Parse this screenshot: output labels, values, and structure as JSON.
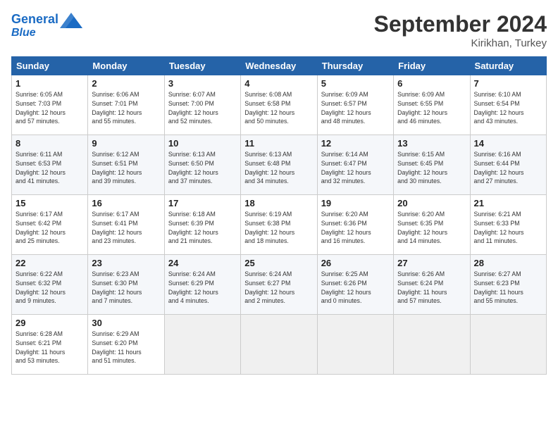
{
  "header": {
    "logo_line1": "General",
    "logo_line2": "Blue",
    "month_title": "September 2024",
    "location": "Kirikhan, Turkey"
  },
  "weekdays": [
    "Sunday",
    "Monday",
    "Tuesday",
    "Wednesday",
    "Thursday",
    "Friday",
    "Saturday"
  ],
  "weeks": [
    [
      {
        "day": "1",
        "sunrise": "6:05 AM",
        "sunset": "7:03 PM",
        "daylight": "12 hours and 57 minutes."
      },
      {
        "day": "2",
        "sunrise": "6:06 AM",
        "sunset": "7:01 PM",
        "daylight": "12 hours and 55 minutes."
      },
      {
        "day": "3",
        "sunrise": "6:07 AM",
        "sunset": "7:00 PM",
        "daylight": "12 hours and 52 minutes."
      },
      {
        "day": "4",
        "sunrise": "6:08 AM",
        "sunset": "6:58 PM",
        "daylight": "12 hours and 50 minutes."
      },
      {
        "day": "5",
        "sunrise": "6:09 AM",
        "sunset": "6:57 PM",
        "daylight": "12 hours and 48 minutes."
      },
      {
        "day": "6",
        "sunrise": "6:09 AM",
        "sunset": "6:55 PM",
        "daylight": "12 hours and 46 minutes."
      },
      {
        "day": "7",
        "sunrise": "6:10 AM",
        "sunset": "6:54 PM",
        "daylight": "12 hours and 43 minutes."
      }
    ],
    [
      {
        "day": "8",
        "sunrise": "6:11 AM",
        "sunset": "6:53 PM",
        "daylight": "12 hours and 41 minutes."
      },
      {
        "day": "9",
        "sunrise": "6:12 AM",
        "sunset": "6:51 PM",
        "daylight": "12 hours and 39 minutes."
      },
      {
        "day": "10",
        "sunrise": "6:13 AM",
        "sunset": "6:50 PM",
        "daylight": "12 hours and 37 minutes."
      },
      {
        "day": "11",
        "sunrise": "6:13 AM",
        "sunset": "6:48 PM",
        "daylight": "12 hours and 34 minutes."
      },
      {
        "day": "12",
        "sunrise": "6:14 AM",
        "sunset": "6:47 PM",
        "daylight": "12 hours and 32 minutes."
      },
      {
        "day": "13",
        "sunrise": "6:15 AM",
        "sunset": "6:45 PM",
        "daylight": "12 hours and 30 minutes."
      },
      {
        "day": "14",
        "sunrise": "6:16 AM",
        "sunset": "6:44 PM",
        "daylight": "12 hours and 27 minutes."
      }
    ],
    [
      {
        "day": "15",
        "sunrise": "6:17 AM",
        "sunset": "6:42 PM",
        "daylight": "12 hours and 25 minutes."
      },
      {
        "day": "16",
        "sunrise": "6:17 AM",
        "sunset": "6:41 PM",
        "daylight": "12 hours and 23 minutes."
      },
      {
        "day": "17",
        "sunrise": "6:18 AM",
        "sunset": "6:39 PM",
        "daylight": "12 hours and 21 minutes."
      },
      {
        "day": "18",
        "sunrise": "6:19 AM",
        "sunset": "6:38 PM",
        "daylight": "12 hours and 18 minutes."
      },
      {
        "day": "19",
        "sunrise": "6:20 AM",
        "sunset": "6:36 PM",
        "daylight": "12 hours and 16 minutes."
      },
      {
        "day": "20",
        "sunrise": "6:20 AM",
        "sunset": "6:35 PM",
        "daylight": "12 hours and 14 minutes."
      },
      {
        "day": "21",
        "sunrise": "6:21 AM",
        "sunset": "6:33 PM",
        "daylight": "12 hours and 11 minutes."
      }
    ],
    [
      {
        "day": "22",
        "sunrise": "6:22 AM",
        "sunset": "6:32 PM",
        "daylight": "12 hours and 9 minutes."
      },
      {
        "day": "23",
        "sunrise": "6:23 AM",
        "sunset": "6:30 PM",
        "daylight": "12 hours and 7 minutes."
      },
      {
        "day": "24",
        "sunrise": "6:24 AM",
        "sunset": "6:29 PM",
        "daylight": "12 hours and 4 minutes."
      },
      {
        "day": "25",
        "sunrise": "6:24 AM",
        "sunset": "6:27 PM",
        "daylight": "12 hours and 2 minutes."
      },
      {
        "day": "26",
        "sunrise": "6:25 AM",
        "sunset": "6:26 PM",
        "daylight": "12 hours and 0 minutes."
      },
      {
        "day": "27",
        "sunrise": "6:26 AM",
        "sunset": "6:24 PM",
        "daylight": "11 hours and 57 minutes."
      },
      {
        "day": "28",
        "sunrise": "6:27 AM",
        "sunset": "6:23 PM",
        "daylight": "11 hours and 55 minutes."
      }
    ],
    [
      {
        "day": "29",
        "sunrise": "6:28 AM",
        "sunset": "6:21 PM",
        "daylight": "11 hours and 53 minutes."
      },
      {
        "day": "30",
        "sunrise": "6:29 AM",
        "sunset": "6:20 PM",
        "daylight": "11 hours and 51 minutes."
      },
      null,
      null,
      null,
      null,
      null
    ]
  ]
}
